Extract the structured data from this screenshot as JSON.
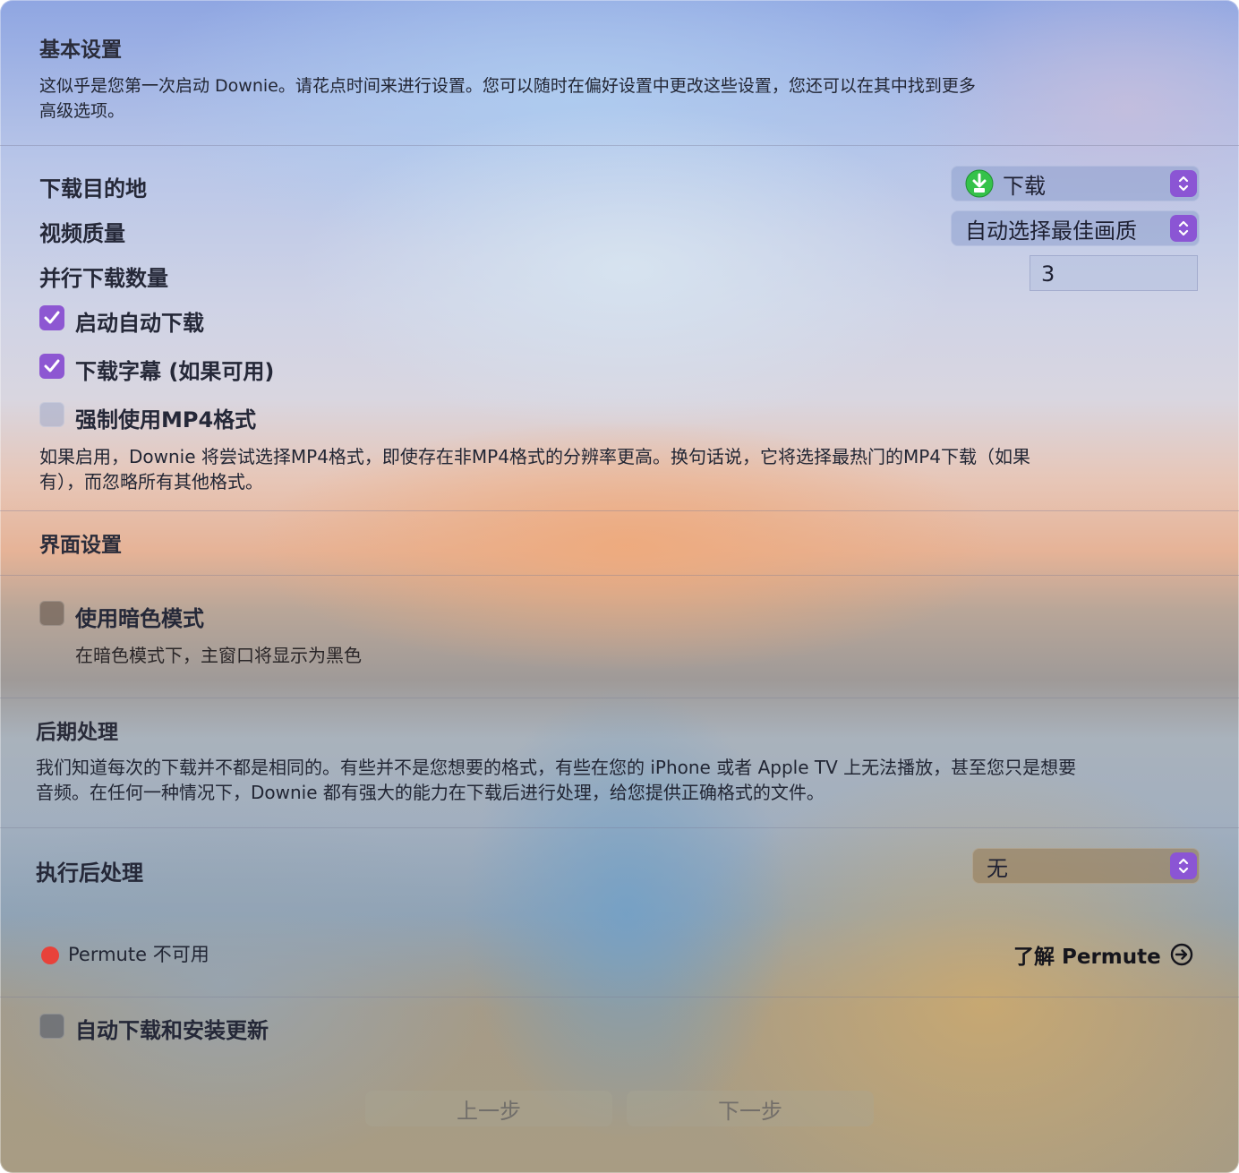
{
  "basic": {
    "title": "基本设置",
    "desc_line1": "这似乎是您第一次启动 Downie。请花点时间来进行设置。您可以随时在偏好设置中更改这些设置，您还可以在其中找到更多",
    "desc_line2": "高级选项。"
  },
  "download": {
    "destination_label": "下载目的地",
    "destination_value": "下载",
    "quality_label": "视频质量",
    "quality_value": "自动选择最佳画质",
    "parallel_label": "并行下载数量",
    "parallel_value": "3",
    "auto_start_label": "启动自动下载",
    "auto_start_checked": true,
    "subtitles_label": "下载字幕 (如果可用)",
    "subtitles_checked": true,
    "mp4_label": "强制使用MP4格式",
    "mp4_checked": false,
    "mp4_desc_line1": "如果启用，Downie 将尝试选择MP4格式，即使存在非MP4格式的分辨率更高。换句话说，它将选择最热门的MP4下载（如果",
    "mp4_desc_line2": "有），而忽略所有其他格式。"
  },
  "interface": {
    "title": "界面设置",
    "dark_mode_label": "使用暗色模式",
    "dark_mode_checked": false,
    "dark_mode_desc": "在暗色模式下，主窗口将显示为黑色"
  },
  "postprocess": {
    "title": "后期处理",
    "desc_line1": "我们知道每次的下载并不都是相同的。有些并不是您想要的格式，有些在您的 iPhone 或者 Apple TV 上无法播放，甚至您只是想要",
    "desc_line2": "音频。在任何一种情况下，Downie 都有强大的能力在下载后进行处理，给您提供正确格式的文件。",
    "run_label": "执行后处理",
    "run_value": "无",
    "permute_status": "Permute 不可用",
    "permute_link": "了解 Permute"
  },
  "updates": {
    "auto_update_label": "自动下载和安装更新",
    "auto_update_checked": false
  },
  "nav": {
    "prev": "上一步",
    "next": "下一步"
  },
  "colors": {
    "accent": "#8d57d2",
    "status_red": "#e8423a",
    "green_icon": "#35c24a"
  }
}
